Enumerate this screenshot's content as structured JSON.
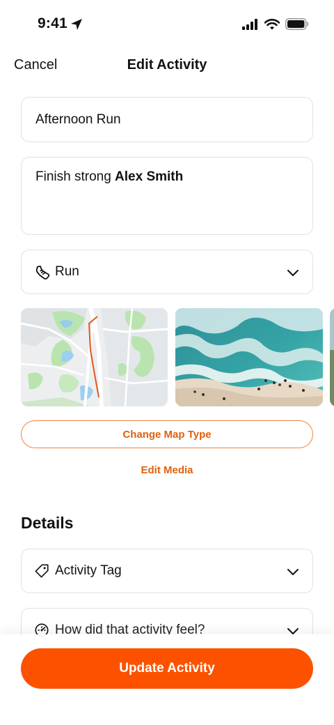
{
  "status_bar": {
    "time": "9:41"
  },
  "nav": {
    "cancel_label": "Cancel",
    "title": "Edit Activity"
  },
  "form": {
    "title_value": "Afternoon Run",
    "description_text": "Finish strong ",
    "description_mention": "Alex Smith",
    "activity_type": "Run"
  },
  "media": {
    "change_map_label": "Change Map Type",
    "edit_media_label": "Edit Media"
  },
  "details": {
    "heading": "Details",
    "tag_label": "Activity Tag",
    "feel_label": "How did that activity feel?"
  },
  "footer": {
    "update_label": "Update Activity"
  },
  "colors": {
    "accent": "#fc5200",
    "accent_text": "#e1600d",
    "border": "#e2e2e2"
  },
  "icons": [
    "location-arrow-icon",
    "signal-icon",
    "wifi-icon",
    "battery-icon",
    "shoe-icon",
    "chevron-down-icon",
    "tag-icon",
    "gauge-icon"
  ]
}
